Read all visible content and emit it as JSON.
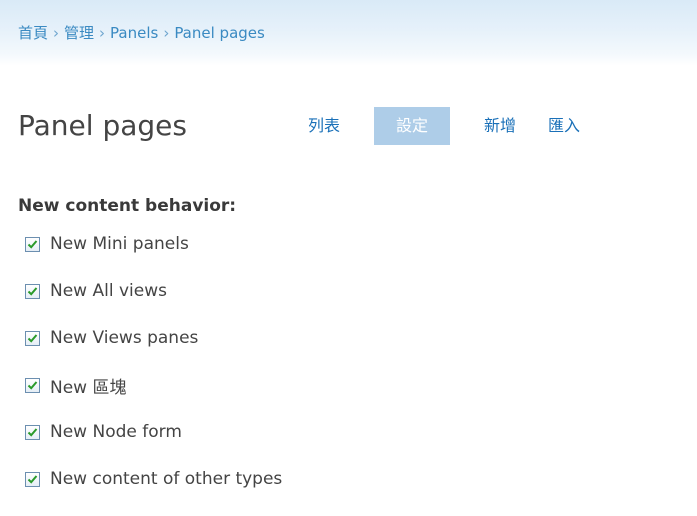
{
  "breadcrumb": {
    "items": [
      "首頁",
      "管理",
      "Panels",
      "Panel pages"
    ],
    "separator": "›"
  },
  "page": {
    "title": "Panel pages"
  },
  "tabs": [
    {
      "label": "列表",
      "active": false
    },
    {
      "label": "設定",
      "active": true
    },
    {
      "label": "新增",
      "active": false
    },
    {
      "label": "匯入",
      "active": false
    }
  ],
  "settings": {
    "section_title": "New content behavior:",
    "options": [
      {
        "label": "New Mini panels",
        "checked": true
      },
      {
        "label": "New All views",
        "checked": true
      },
      {
        "label": "New Views panes",
        "checked": true
      },
      {
        "label": "New 區塊",
        "checked": true
      },
      {
        "label": "New Node form",
        "checked": true
      },
      {
        "label": "New content of other types",
        "checked": true
      }
    ]
  },
  "colors": {
    "link": "#1a70b8",
    "active_tab_bg": "#aecde8",
    "checkmark": "#2a9a2a"
  }
}
